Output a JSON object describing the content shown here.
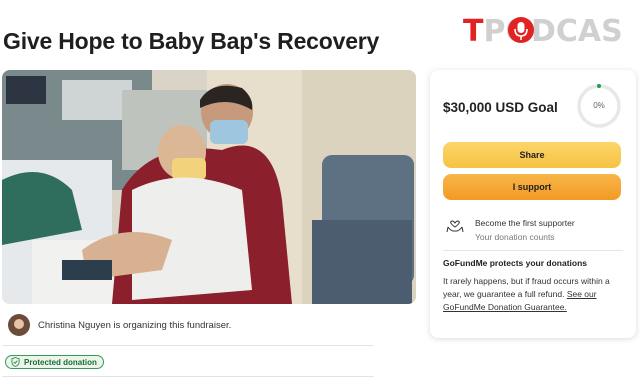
{
  "page": {
    "title": "Give Hope to Baby Bap's Recovery"
  },
  "watermark": {
    "text_first": "T",
    "text_rest": "PODCAS",
    "colors": {
      "accent": "#e02424",
      "muted": "#d0d0d0"
    }
  },
  "organizer": {
    "text": "Christina Nguyen is organizing this fundraiser."
  },
  "badge": {
    "label": "Protected donation",
    "icon": "shield-check-icon"
  },
  "donation_card": {
    "goal": "$30,000 USD Goal",
    "progress_percent_label": "0%",
    "progress_fraction": 0.0,
    "share_label": "Share",
    "support_label": "I support",
    "first_supporter_title": "Become the first supporter",
    "first_supporter_subtitle": "Your donation counts",
    "first_supporter_icon": "heart-hands-icon",
    "protects_title": "GoFundMe protects your donations",
    "protects_text": "It rarely happens, but if fraud occurs within a year, we guarantee a full refund. ",
    "protects_link": "See our GoFundMe Donation Guarantee."
  },
  "colors": {
    "share_button": "#f8cc55",
    "support_button": "#f5a732",
    "badge_green": "#3a9a54",
    "progress_ring": "#e8e8e8",
    "progress_dot": "#1e9e4a"
  }
}
